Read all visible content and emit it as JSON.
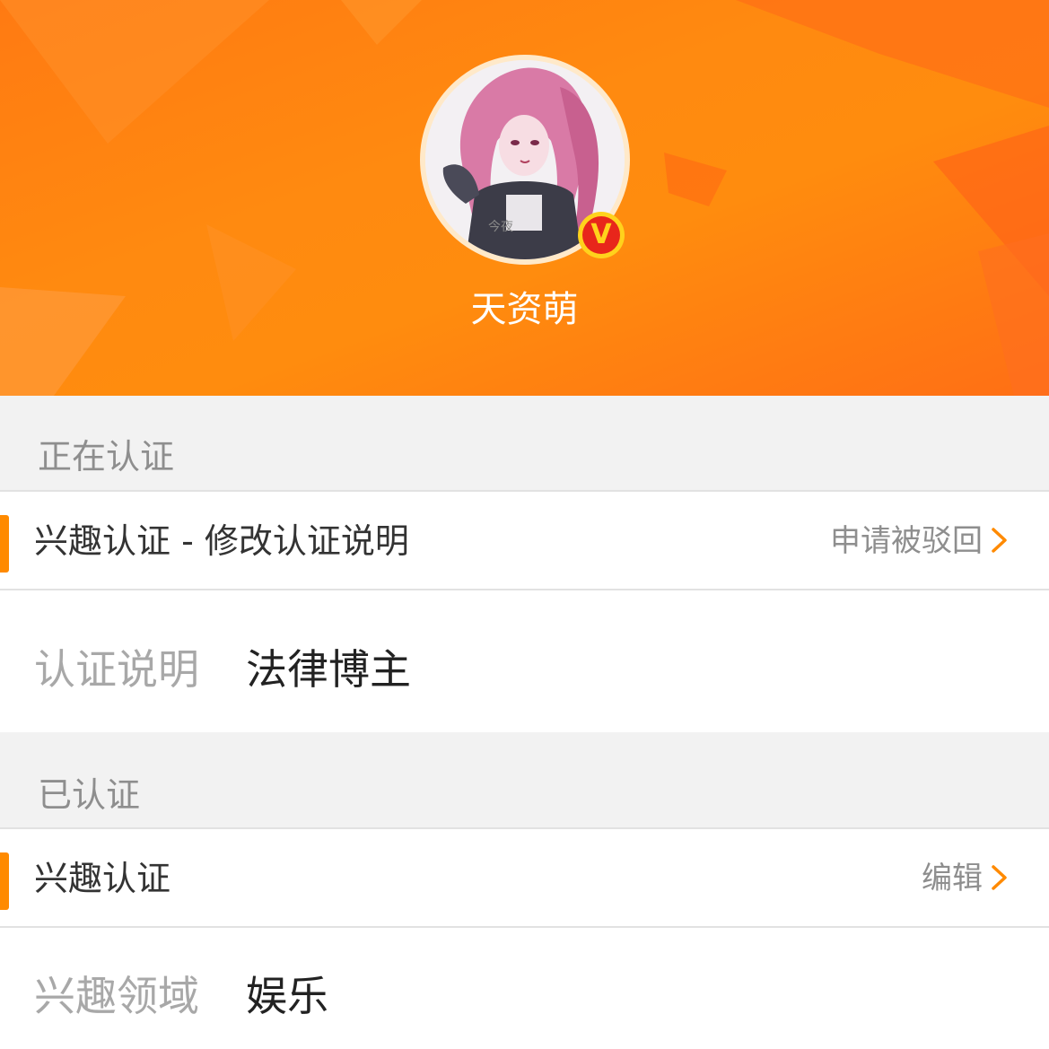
{
  "profile": {
    "username": "天资萌",
    "verified_badge": "V",
    "avatar_icon": "anime-avatar"
  },
  "pending_section": {
    "label": "正在认证",
    "item_title": "兴趣认证 - 修改认证说明",
    "item_status": "申请被驳回",
    "detail_key": "认证说明",
    "detail_value": "法律博主"
  },
  "verified_section": {
    "label": "已认证",
    "item_title": "兴趣认证",
    "item_action": "编辑",
    "detail_key": "兴趣领域",
    "detail_value": "娱乐"
  },
  "colors": {
    "accent": "#ff8a00",
    "header_orange": "#ff7a12",
    "badge_red": "#e8261b",
    "badge_yellow": "#ffd21c"
  }
}
